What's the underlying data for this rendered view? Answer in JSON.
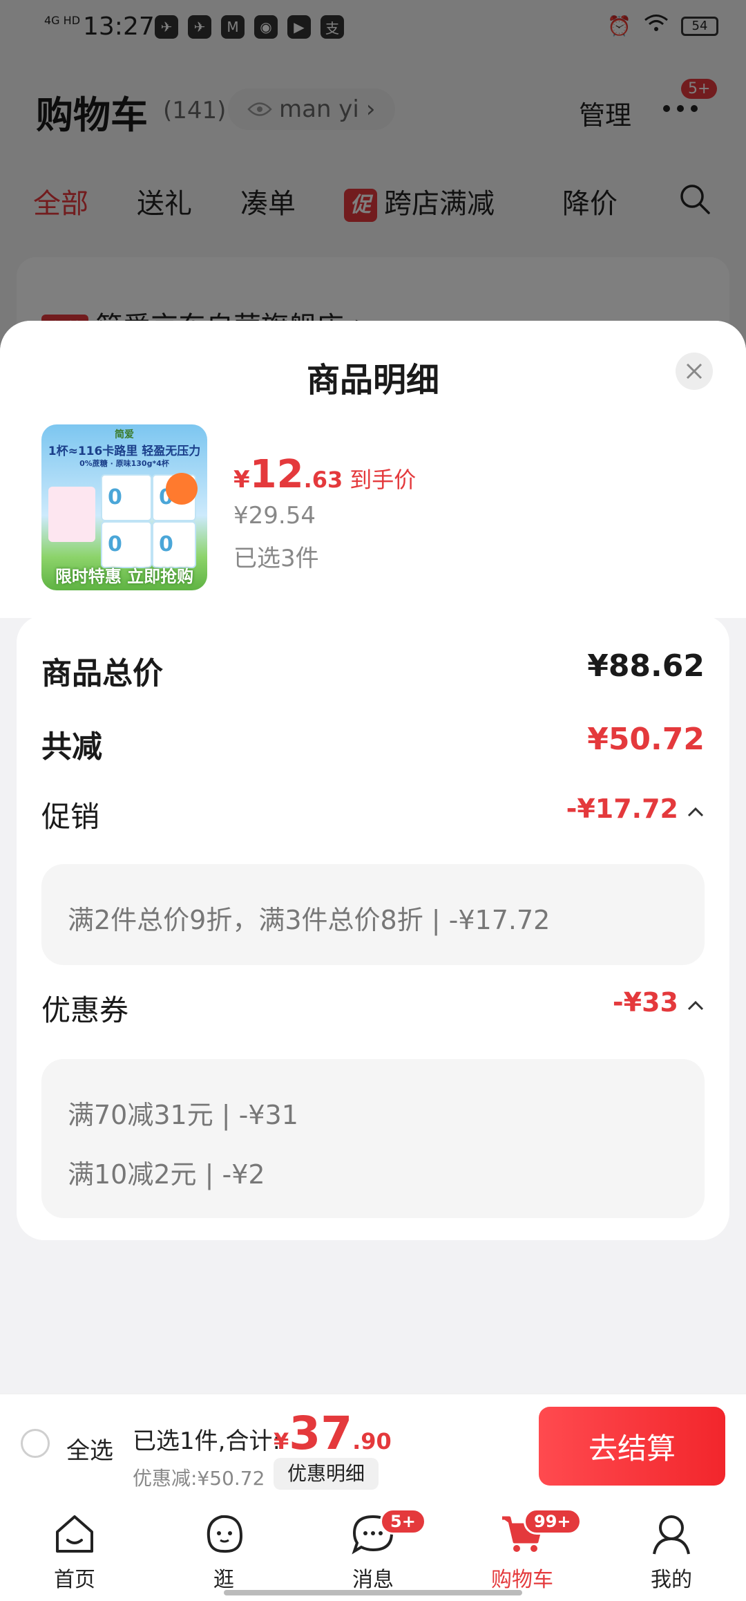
{
  "status_bar": {
    "time": "13:27",
    "network": "4G HD",
    "battery": "54",
    "apps": [
      "bird-icon",
      "bird-icon",
      "m-app-icon",
      "location-app-icon",
      "play-icon",
      "alipay-icon"
    ]
  },
  "header": {
    "title": "购物车",
    "count": "(141)",
    "user": "man yi",
    "manage": "管理",
    "more_badge": "5+"
  },
  "tabs": [
    {
      "label": "全部",
      "active": true
    },
    {
      "label": "送礼"
    },
    {
      "label": "凑单"
    },
    {
      "label": "跨店满减",
      "tag": "促"
    },
    {
      "label": "降价"
    }
  ],
  "store": {
    "tag": "自营",
    "name": "简爱京东自营旗舰店 >"
  },
  "sheet": {
    "title": "商品明细",
    "product": {
      "image_text": {
        "brand": "简爱",
        "headline": "1杯≈116卡路里 轻盈无压力",
        "spec": "0%蔗糖 · 原味130g*4杯",
        "banner": "限时特惠 立即抢购"
      },
      "price_yen": "¥",
      "price_int": "12",
      "price_dec": ".63",
      "price_tail": "到手价",
      "original_price": "¥29.54",
      "selected": "已选3件"
    },
    "total_label": "商品总价",
    "total_value": "¥88.62",
    "reduce_label": "共减",
    "reduce_value": "¥50.72",
    "promo": {
      "label": "促销",
      "value": "-¥17.72",
      "lines": [
        "满2件总价9折，满3件总价8折 | -¥17.72"
      ]
    },
    "coupon": {
      "label": "优惠券",
      "value": "-¥33",
      "lines": [
        "满70减31元 | -¥31",
        "满10减2元 | -¥2"
      ]
    }
  },
  "checkout": {
    "select_all": "全选",
    "summary": "已选1件,合计:",
    "total_yen": "¥",
    "total_int": "37",
    "total_dec": ".90",
    "discount": "优惠减:¥50.72",
    "detail_button": "优惠明细",
    "checkout_button": "去结算"
  },
  "nav": [
    {
      "label": "首页",
      "icon": "home-icon"
    },
    {
      "label": "逛",
      "icon": "mascot-icon"
    },
    {
      "label": "消息",
      "icon": "message-icon",
      "badge": "5+"
    },
    {
      "label": "购物车",
      "icon": "cart-icon",
      "badge": "99+",
      "active": true
    },
    {
      "label": "我的",
      "icon": "profile-icon"
    }
  ],
  "colors": {
    "accent": "#e4393c",
    "sheet_bg": "#f2f2f4"
  }
}
